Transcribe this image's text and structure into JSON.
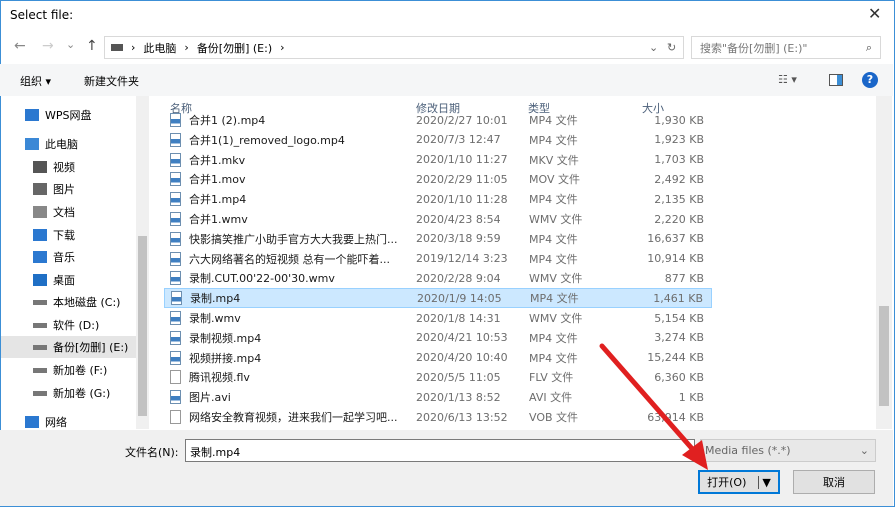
{
  "window": {
    "title": "Select file:",
    "close": "✕"
  },
  "address": {
    "back": "←",
    "forward": "→",
    "recent": "⌄",
    "up": "↑",
    "crumbs": [
      "此电脑",
      "备份[勿删] (E:)"
    ],
    "sep": "›",
    "dropdown": "⌄",
    "refresh": "↻"
  },
  "search": {
    "placeholder": "搜索\"备份[勿删] (E:)\"",
    "icon": "⌕"
  },
  "toolbar": {
    "organize": "组织 ▾",
    "new_folder": "新建文件夹",
    "view": "☷ ▾",
    "pane": "▯",
    "help": "?"
  },
  "sidebar": {
    "items": [
      {
        "label": "WPS网盘",
        "icon": "cloud-icon"
      },
      {
        "label": "此电脑",
        "icon": "computer-icon"
      },
      {
        "label": "视频",
        "icon": "video-icon"
      },
      {
        "label": "图片",
        "icon": "picture-icon"
      },
      {
        "label": "文档",
        "icon": "document-icon"
      },
      {
        "label": "下载",
        "icon": "download-icon"
      },
      {
        "label": "音乐",
        "icon": "music-icon"
      },
      {
        "label": "桌面",
        "icon": "desktop-icon"
      },
      {
        "label": "本地磁盘 (C:)",
        "icon": "drive-icon"
      },
      {
        "label": "软件 (D:)",
        "icon": "drive-icon"
      },
      {
        "label": "备份[勿删] (E:)",
        "icon": "drive-icon",
        "selected": true
      },
      {
        "label": "新加卷 (F:)",
        "icon": "drive-icon"
      },
      {
        "label": "新加卷 (G:)",
        "icon": "drive-icon"
      },
      {
        "label": "网络",
        "icon": "network-icon"
      }
    ]
  },
  "columns": {
    "name": "名称",
    "date": "修改日期",
    "type": "类型",
    "size": "大小"
  },
  "files": [
    {
      "name": "合并1 (2).mp4",
      "date": "2020/2/27 10:01",
      "type": "MP4 文件",
      "size": "1,930 KB",
      "video": true
    },
    {
      "name": "合并1(1)_removed_logo.mp4",
      "date": "2020/7/3 12:47",
      "type": "MP4 文件",
      "size": "1,923 KB",
      "video": true
    },
    {
      "name": "合并1.mkv",
      "date": "2020/1/10 11:27",
      "type": "MKV 文件",
      "size": "1,703 KB",
      "video": true
    },
    {
      "name": "合并1.mov",
      "date": "2020/2/29 11:05",
      "type": "MOV 文件",
      "size": "2,492 KB",
      "video": true
    },
    {
      "name": "合并1.mp4",
      "date": "2020/1/10 11:28",
      "type": "MP4 文件",
      "size": "2,135 KB",
      "video": true
    },
    {
      "name": "合并1.wmv",
      "date": "2020/4/23 8:54",
      "type": "WMV 文件",
      "size": "2,220 KB",
      "video": true
    },
    {
      "name": "快影搞笑推广小助手官方大大我要上热门...",
      "date": "2020/3/18 9:59",
      "type": "MP4 文件",
      "size": "16,637 KB",
      "video": true
    },
    {
      "name": "六大网络著名的短视频 总有一个能吓着...",
      "date": "2019/12/14 3:23",
      "type": "MP4 文件",
      "size": "10,914 KB",
      "video": true
    },
    {
      "name": "录制.CUT.00'22-00'30.wmv",
      "date": "2020/2/28 9:04",
      "type": "WMV 文件",
      "size": "877 KB",
      "video": true
    },
    {
      "name": "录制.mp4",
      "date": "2020/1/9 14:05",
      "type": "MP4 文件",
      "size": "1,461 KB",
      "video": true,
      "selected": true
    },
    {
      "name": "录制.wmv",
      "date": "2020/1/8 14:31",
      "type": "WMV 文件",
      "size": "5,154 KB",
      "video": true
    },
    {
      "name": "录制视频.mp4",
      "date": "2020/4/21 10:53",
      "type": "MP4 文件",
      "size": "3,274 KB",
      "video": true
    },
    {
      "name": "视频拼接.mp4",
      "date": "2020/4/20 10:40",
      "type": "MP4 文件",
      "size": "15,244 KB",
      "video": true
    },
    {
      "name": "腾讯视频.flv",
      "date": "2020/5/5 11:05",
      "type": "FLV 文件",
      "size": "6,360 KB",
      "video": false
    },
    {
      "name": "图片.avi",
      "date": "2020/1/13 8:52",
      "type": "AVI 文件",
      "size": "1 KB",
      "video": true
    },
    {
      "name": "网络安全教育视频，进来我们一起学习吧...",
      "date": "2020/6/13 13:52",
      "type": "VOB 文件",
      "size": "63,914 KB",
      "video": false
    }
  ],
  "bottom": {
    "filename_label": "文件名(N):",
    "filename_value": "录制.mp4",
    "filter": "Media files (*.*)",
    "open": "打开(O)",
    "open_arrow": "▼",
    "cancel": "取消"
  },
  "colors": {
    "accent": "#0078d7",
    "selection": "#cce8ff",
    "arrow": "#e02020"
  }
}
